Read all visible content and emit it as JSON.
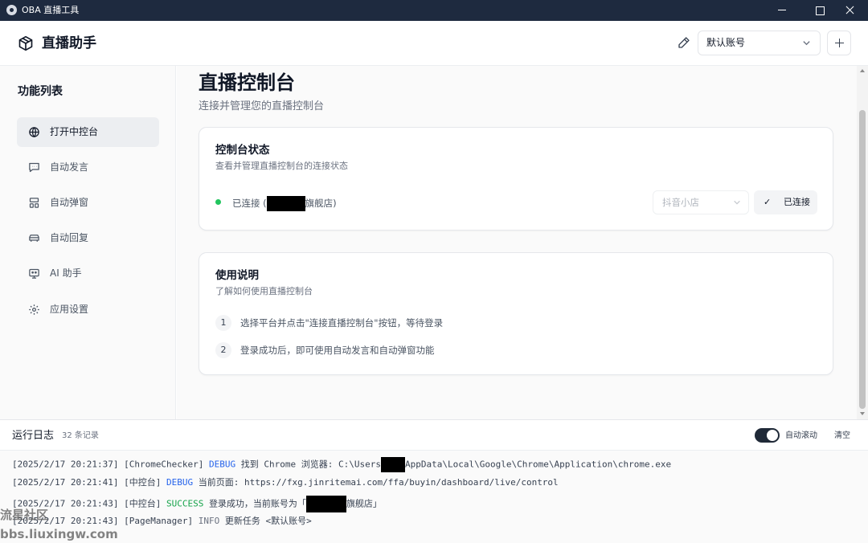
{
  "window": {
    "title": "OBA 直播工具"
  },
  "header": {
    "brand_title": "直播助手",
    "account_selected": "默认账号"
  },
  "sidebar": {
    "heading": "功能列表",
    "items": [
      {
        "label": "打开中控台",
        "icon": "globe-icon",
        "active": true
      },
      {
        "label": "自动发言",
        "icon": "message-icon"
      },
      {
        "label": "自动弹窗",
        "icon": "layout-icon"
      },
      {
        "label": "自动回复",
        "icon": "car-icon"
      },
      {
        "label": "AI 助手",
        "icon": "robot-icon"
      },
      {
        "label": "应用设置",
        "icon": "gear-icon"
      }
    ]
  },
  "main": {
    "title": "直播控制台",
    "subtitle": "连接并管理您的直播控制台",
    "status_card": {
      "title": "控制台状态",
      "desc": "查看并管理直播控制台的连接状态",
      "status_prefix": "已连接 (",
      "status_suffix": "旗舰店)",
      "platform": "抖音小店",
      "connected_label": "已连接"
    },
    "usage_card": {
      "title": "使用说明",
      "desc": "了解如何使用直播控制台",
      "steps": [
        {
          "num": "1",
          "text": "选择平台并点击\"连接直播控制台\"按钮，等待登录"
        },
        {
          "num": "2",
          "text": "登录成功后，即可使用自动发言和自动弹窗功能"
        }
      ]
    }
  },
  "log": {
    "title": "运行日志",
    "count": "32 条记录",
    "autoscroll_label": "自动滚动",
    "autoscroll_on": true,
    "clear_label": "清空",
    "lines": [
      {
        "time": "[2025/2/17 20:21:37]",
        "source": "[ChromeChecker]",
        "level": "DEBUG",
        "msg_a": "找到 Chrome 浏览器: C:\\Users",
        "msg_b": "AppData\\Local\\Google\\Chrome\\Application\\chrome.exe"
      },
      {
        "time": "[2025/2/17 20:21:41]",
        "source": "[中控台]",
        "level": "DEBUG",
        "msg_a": "当前页面: https://fxg.jinritemai.com/ffa/buyin/dashboard/live/control",
        "msg_b": ""
      },
      {
        "time": "[2025/2/17 20:21:43]",
        "source": "[中控台]",
        "level": "SUCCESS",
        "msg_a": "登录成功，当前账号为「",
        "msg_b": "旗舰店」"
      },
      {
        "time": "[2025/2/17 20:21:43]",
        "source": "[PageManager]",
        "level": "INFO",
        "msg_a": "更新任务 <默认账号>",
        "msg_b": ""
      }
    ]
  },
  "watermark": {
    "line1": "流星社区",
    "line2": "bbs.liuxingw.com"
  },
  "colors": {
    "titlebar": "#1e2a3f",
    "status_ok": "#22c55e",
    "debug": "#2563eb",
    "success": "#16a34a"
  }
}
